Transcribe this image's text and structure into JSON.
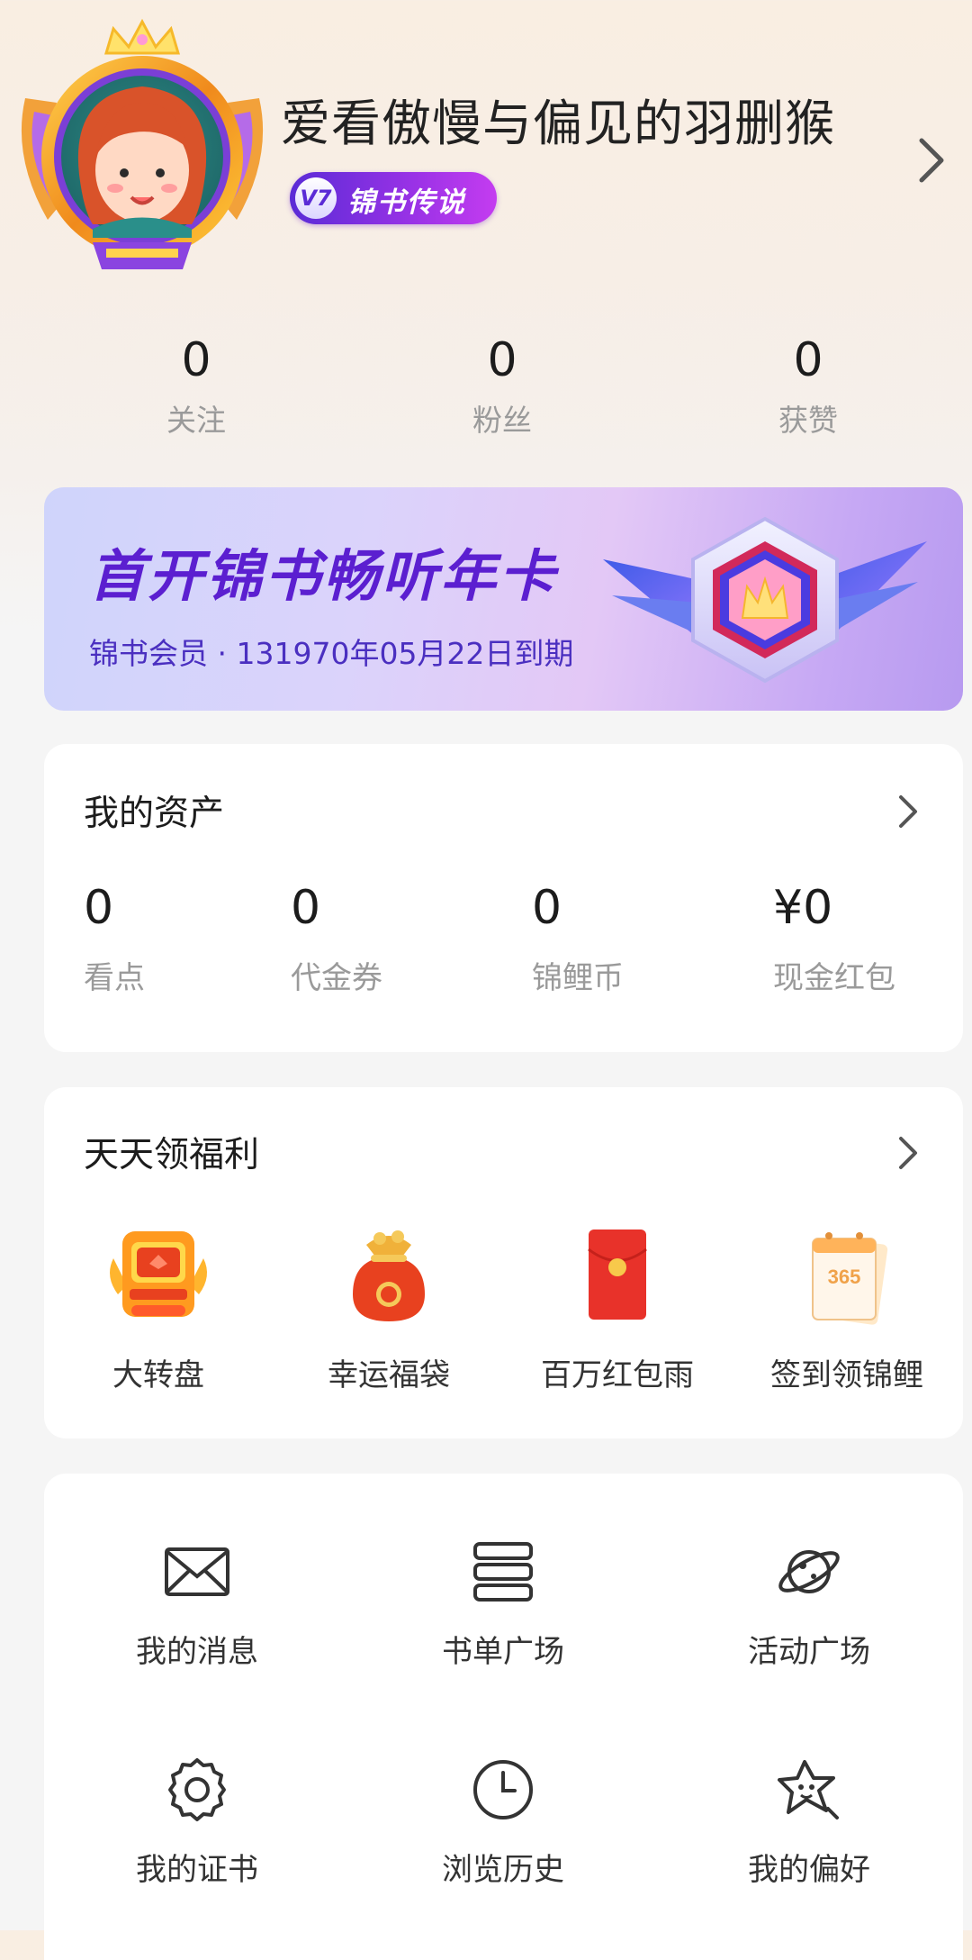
{
  "profile": {
    "username": "爱看傲慢与偏见的羽删猴",
    "vip_level": "V7",
    "vip_title": "锦书传说"
  },
  "stats": [
    {
      "value": "0",
      "label": "关注"
    },
    {
      "value": "0",
      "label": "粉丝"
    },
    {
      "value": "0",
      "label": "获赞"
    }
  ],
  "banner": {
    "title": "首开锦书畅听年卡",
    "subtitle": "锦书会员 · 131970年05月22日到期"
  },
  "assets": {
    "title": "我的资产",
    "items": [
      {
        "value": "0",
        "label": "看点"
      },
      {
        "value": "0",
        "label": "代金券"
      },
      {
        "value": "0",
        "label": "锦鲤币"
      },
      {
        "value": "¥0",
        "label": "现金红包"
      }
    ]
  },
  "benefits": {
    "title": "天天领福利",
    "items": [
      {
        "label": "大转盘",
        "icon": "prize-wheel-machine-icon"
      },
      {
        "label": "幸运福袋",
        "icon": "lucky-bag-icon"
      },
      {
        "label": "百万红包雨",
        "icon": "red-envelope-icon"
      },
      {
        "label": "签到领锦鲤",
        "icon": "calendar-365-icon"
      }
    ]
  },
  "tools": [
    {
      "label": "我的消息",
      "icon": "envelope-icon"
    },
    {
      "label": "书单广场",
      "icon": "book-stack-icon"
    },
    {
      "label": "活动广场",
      "icon": "planet-icon"
    },
    {
      "label": "我的证书",
      "icon": "certificate-badge-icon"
    },
    {
      "label": "浏览历史",
      "icon": "clock-icon"
    },
    {
      "label": "我的偏好",
      "icon": "star-face-icon"
    }
  ],
  "colors": {
    "accent_purple": "#5b1fd0",
    "vip_badge": "#9a32e6",
    "muted_text": "#9a9a9a"
  }
}
